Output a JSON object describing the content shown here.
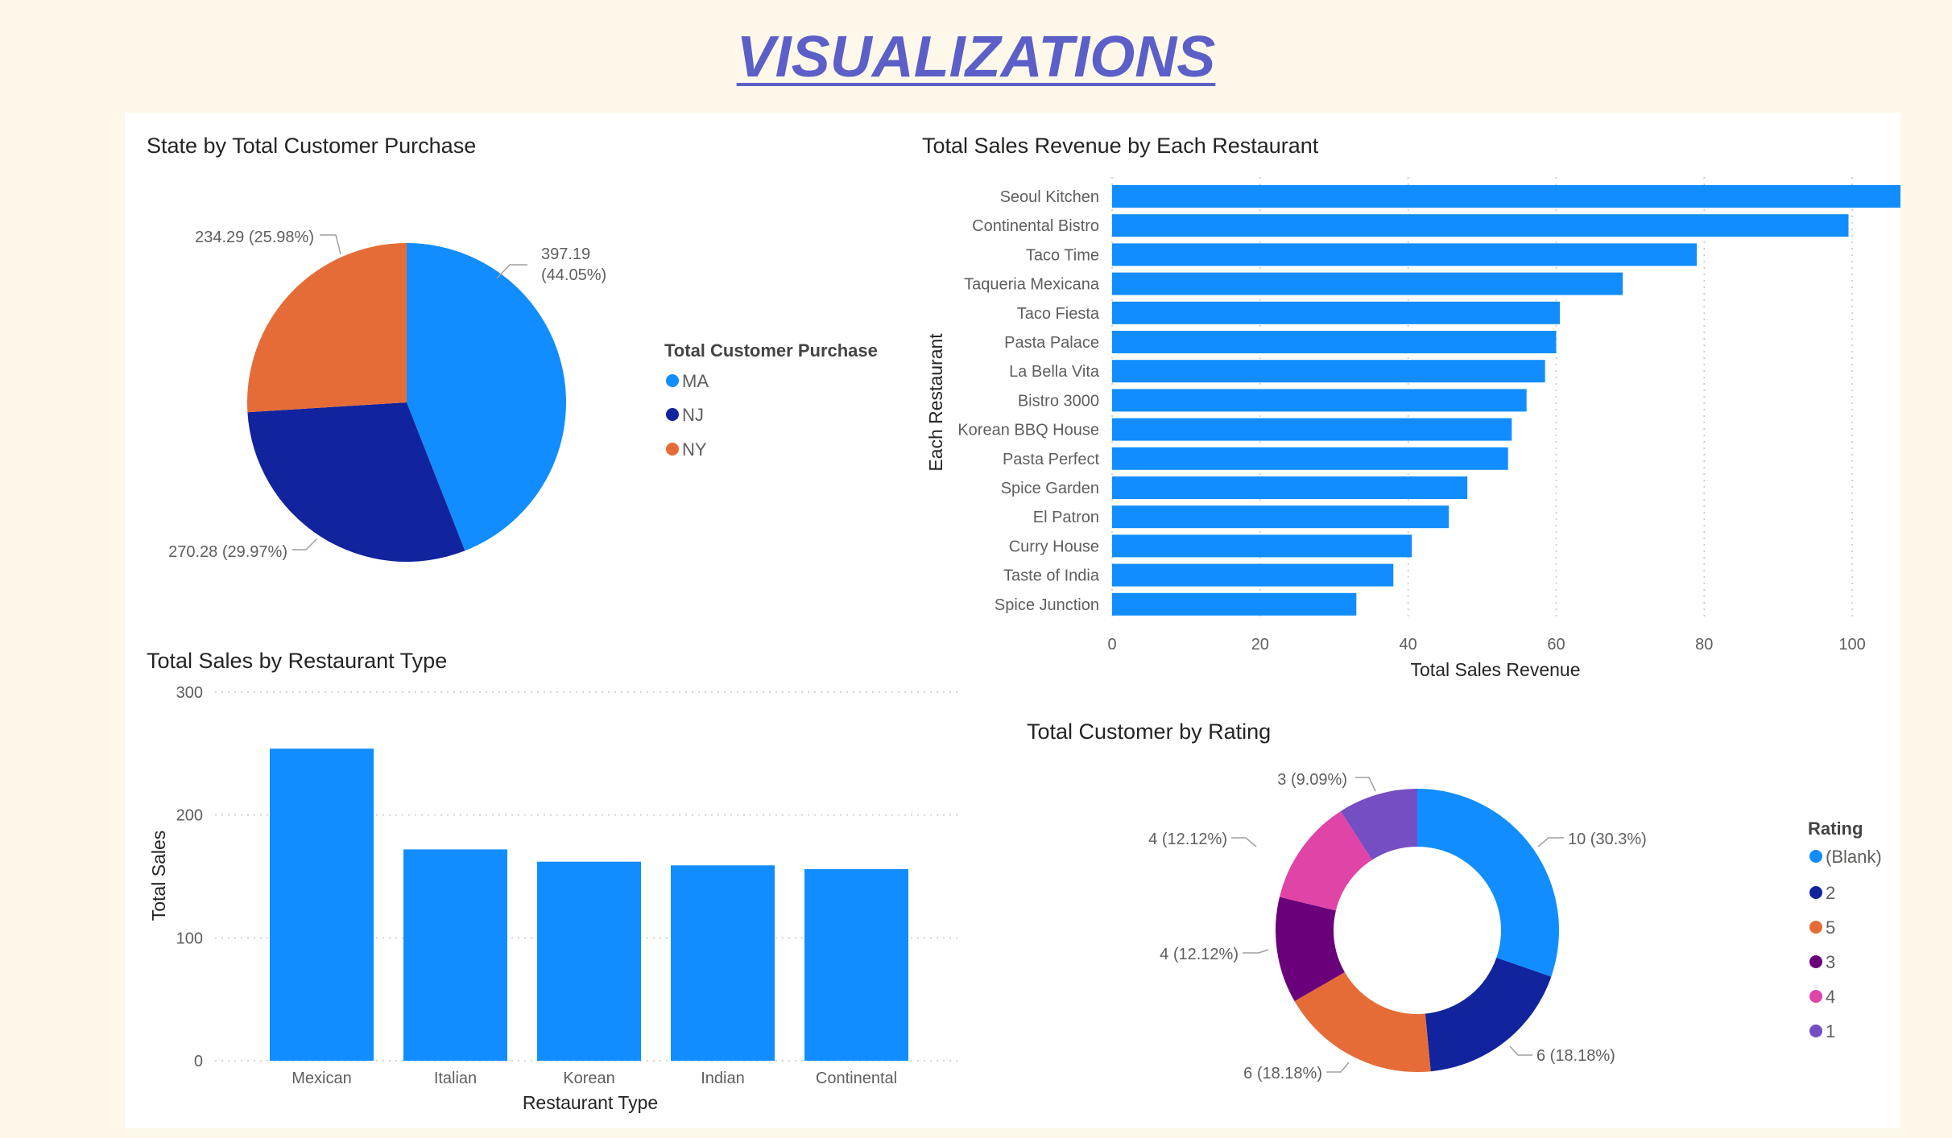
{
  "page": {
    "title": "VISUALIZATIONS"
  },
  "chart_data": [
    {
      "type": "pie",
      "title": "State by Total Customer Purchase",
      "legend_title": "Total Customer Purchase",
      "legend_placement": "right",
      "slices": [
        {
          "name": "MA",
          "value": 397.19,
          "label_value": "397.19",
          "label_pct": "(44.05%)",
          "color": "#118dff"
        },
        {
          "name": "NJ",
          "value": 270.28,
          "label": "270.28 (29.97%)",
          "color": "#12239e"
        },
        {
          "name": "NY",
          "value": 234.29,
          "label": "234.29 (25.98%)",
          "color": "#e66c37"
        }
      ]
    },
    {
      "type": "bar",
      "orientation": "horizontal",
      "title": "Total Sales Revenue by Each Restaurant",
      "xlabel": "Total Sales Revenue",
      "ylabel": "Each Restaurant",
      "xlim": [
        0,
        110
      ],
      "xticks": [
        "0",
        "20",
        "40",
        "60",
        "80",
        "100"
      ],
      "grid": true,
      "color": "#118dff",
      "categories": [
        "Seoul Kitchen",
        "Continental Bistro",
        "Taco Time",
        "Taqueria Mexicana",
        "Taco Fiesta",
        "Pasta Palace",
        "La Bella Vita",
        "Bistro 3000",
        "Korean BBQ House",
        "Pasta Perfect",
        "Spice Garden",
        "El Patron",
        "Curry House",
        "Taste of India",
        "Spice Junction"
      ],
      "values": [
        107.5,
        99.5,
        79,
        69,
        60.5,
        60,
        58.5,
        56,
        54,
        53.5,
        48,
        45.5,
        40.5,
        38,
        33
      ]
    },
    {
      "type": "bar",
      "orientation": "vertical",
      "title": "Total Sales by Restaurant Type",
      "xlabel": "Restaurant Type",
      "ylabel": "Total Sales",
      "ylim": [
        0,
        300
      ],
      "yticks": [
        "0",
        "100",
        "200",
        "300"
      ],
      "grid": true,
      "color": "#118dff",
      "categories": [
        "Mexican",
        "Italian",
        "Korean",
        "Indian",
        "Continental"
      ],
      "values": [
        254,
        172,
        162,
        159,
        156
      ]
    },
    {
      "type": "pie",
      "subtype": "donut",
      "title": "Total Customer by Rating",
      "legend_title": "Rating",
      "legend_placement": "right",
      "slices": [
        {
          "name": "(Blank)",
          "value": 10,
          "label": "10 (30.3%)",
          "color": "#118dff"
        },
        {
          "name": "2",
          "value": 6,
          "label": "6 (18.18%)",
          "color": "#12239e"
        },
        {
          "name": "5",
          "value": 6,
          "label": "6 (18.18%)",
          "color": "#e66c37"
        },
        {
          "name": "3",
          "value": 4,
          "label": "4 (12.12%)",
          "color": "#6b007b"
        },
        {
          "name": "4",
          "value": 4,
          "label": "4 (12.12%)",
          "color": "#e044a7"
        },
        {
          "name": "1",
          "value": 3,
          "label": "3 (9.09%)",
          "color": "#744ec2"
        }
      ]
    }
  ]
}
